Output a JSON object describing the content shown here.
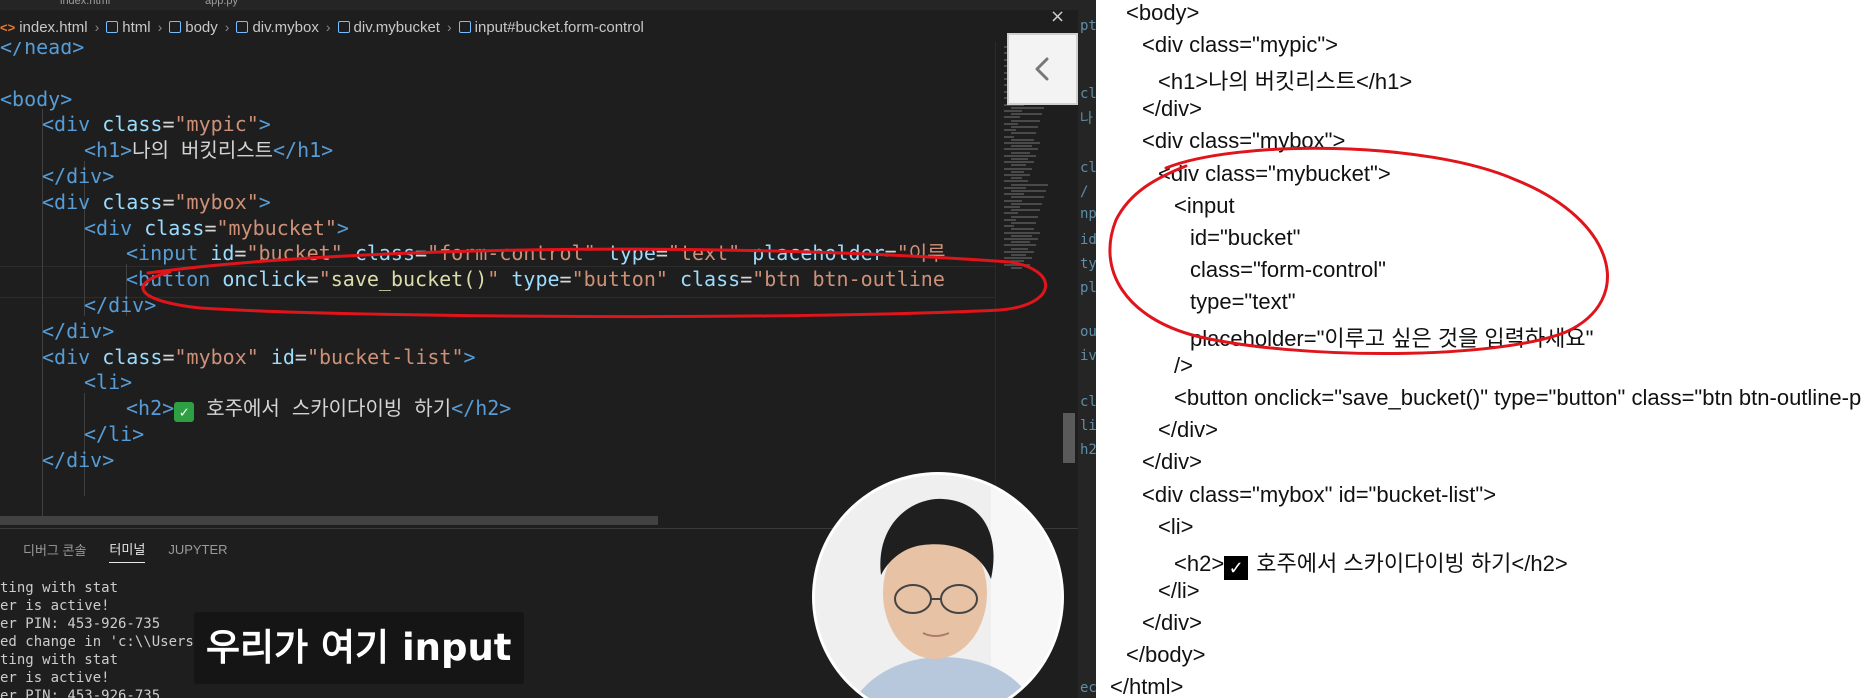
{
  "editor": {
    "tabs": [
      "index.html",
      "app.py"
    ],
    "breadcrumb": [
      "index.html",
      "html",
      "body",
      "div.mybox",
      "div.mybucket",
      "input#bucket.form-control"
    ],
    "code_lines": [
      {
        "indent": 0,
        "tokens": [
          {
            "t": "tag",
            "v": "</head>"
          }
        ]
      },
      {
        "indent": 0,
        "tokens": []
      },
      {
        "indent": 0,
        "tokens": [
          {
            "t": "tag",
            "v": "<body>"
          }
        ]
      },
      {
        "indent": 1,
        "tokens": [
          {
            "t": "tag",
            "v": "<div"
          },
          {
            "t": "txt",
            "v": " "
          },
          {
            "t": "attr",
            "v": "class"
          },
          {
            "t": "txt",
            "v": "="
          },
          {
            "t": "str",
            "v": "\"mypic\""
          },
          {
            "t": "tag",
            "v": ">"
          }
        ]
      },
      {
        "indent": 2,
        "tokens": [
          {
            "t": "tag",
            "v": "<h1>"
          },
          {
            "t": "txt",
            "v": "나의 버킷리스트"
          },
          {
            "t": "tag",
            "v": "</h1>"
          }
        ]
      },
      {
        "indent": 1,
        "tokens": [
          {
            "t": "tag",
            "v": "</div>"
          }
        ]
      },
      {
        "indent": 1,
        "tokens": [
          {
            "t": "tag",
            "v": "<div"
          },
          {
            "t": "txt",
            "v": " "
          },
          {
            "t": "attr",
            "v": "class"
          },
          {
            "t": "txt",
            "v": "="
          },
          {
            "t": "str",
            "v": "\"mybox\""
          },
          {
            "t": "tag",
            "v": ">"
          }
        ]
      },
      {
        "indent": 2,
        "tokens": [
          {
            "t": "tag",
            "v": "<div"
          },
          {
            "t": "txt",
            "v": " "
          },
          {
            "t": "attr",
            "v": "class"
          },
          {
            "t": "txt",
            "v": "="
          },
          {
            "t": "str",
            "v": "\"mybucket\""
          },
          {
            "t": "tag",
            "v": ">"
          }
        ]
      },
      {
        "indent": 3,
        "tokens": [
          {
            "t": "tag",
            "v": "<input"
          },
          {
            "t": "txt",
            "v": " "
          },
          {
            "t": "attr",
            "v": "id"
          },
          {
            "t": "txt",
            "v": "="
          },
          {
            "t": "str",
            "v": "\"bucket\""
          },
          {
            "t": "txt",
            "v": " "
          },
          {
            "t": "attr",
            "v": "class"
          },
          {
            "t": "txt",
            "v": "="
          },
          {
            "t": "str",
            "v": "\"form-control\""
          },
          {
            "t": "txt",
            "v": " "
          },
          {
            "t": "attr",
            "v": "type"
          },
          {
            "t": "txt",
            "v": "="
          },
          {
            "t": "str",
            "v": "\"text\""
          },
          {
            "t": "txt",
            "v": " "
          },
          {
            "t": "attr",
            "v": "placeholder"
          },
          {
            "t": "txt",
            "v": "="
          },
          {
            "t": "str",
            "v": "\"이루"
          }
        ]
      },
      {
        "indent": 3,
        "tokens": [
          {
            "t": "tag",
            "v": "<button"
          },
          {
            "t": "txt",
            "v": " "
          },
          {
            "t": "attr",
            "v": "onclick"
          },
          {
            "t": "txt",
            "v": "="
          },
          {
            "t": "str",
            "v": "\""
          },
          {
            "t": "fn",
            "v": "save_bucket"
          },
          {
            "t": "fn",
            "v": "()"
          },
          {
            "t": "str",
            "v": "\""
          },
          {
            "t": "txt",
            "v": " "
          },
          {
            "t": "attr",
            "v": "type"
          },
          {
            "t": "txt",
            "v": "="
          },
          {
            "t": "str",
            "v": "\"button\""
          },
          {
            "t": "txt",
            "v": " "
          },
          {
            "t": "attr",
            "v": "class"
          },
          {
            "t": "txt",
            "v": "="
          },
          {
            "t": "str",
            "v": "\"btn btn-outline"
          }
        ]
      },
      {
        "indent": 2,
        "tokens": [
          {
            "t": "tag",
            "v": "</div>"
          }
        ]
      },
      {
        "indent": 1,
        "tokens": [
          {
            "t": "tag",
            "v": "</div>"
          }
        ]
      },
      {
        "indent": 1,
        "tokens": [
          {
            "t": "tag",
            "v": "<div"
          },
          {
            "t": "txt",
            "v": " "
          },
          {
            "t": "attr",
            "v": "class"
          },
          {
            "t": "txt",
            "v": "="
          },
          {
            "t": "str",
            "v": "\"mybox\""
          },
          {
            "t": "txt",
            "v": " "
          },
          {
            "t": "attr",
            "v": "id"
          },
          {
            "t": "txt",
            "v": "="
          },
          {
            "t": "str",
            "v": "\"bucket-list\""
          },
          {
            "t": "tag",
            "v": ">"
          }
        ]
      },
      {
        "indent": 2,
        "tokens": [
          {
            "t": "tag",
            "v": "<li>"
          }
        ]
      },
      {
        "indent": 3,
        "tokens": [
          {
            "t": "tag",
            "v": "<h2>"
          },
          {
            "t": "check",
            "v": "✓"
          },
          {
            "t": "txt",
            "v": " 호주에서 스카이다이빙 하기"
          },
          {
            "t": "tag",
            "v": "</h2>"
          }
        ]
      },
      {
        "indent": 2,
        "tokens": [
          {
            "t": "tag",
            "v": "</li>"
          }
        ]
      },
      {
        "indent": 1,
        "tokens": [
          {
            "t": "tag",
            "v": "</div>"
          }
        ]
      }
    ]
  },
  "panel": {
    "tabs": [
      "디버그 콘솔",
      "터미널",
      "JUPYTER"
    ],
    "active_tab": "터미널",
    "close_label": "×",
    "terminal_lines": [
      "ting with stat",
      "er is active!",
      "er PIN: 453-926-735",
      "ed change in 'c:\\\\Users\\                                               bucket\\\\app.py', reloading",
      "ting with stat",
      "er is active!",
      "er PIN: 453-926-735"
    ]
  },
  "subtitle": "우리가 여기 input",
  "right_strip_fragments": [
    "pt",
    "cla",
    "나",
    "cla",
    "/ c",
    "np",
    "id",
    "ty",
    "pl",
    "out",
    "iv",
    "cla",
    "li",
    "h2",
    "ec"
  ],
  "slide": {
    "lines": [
      {
        "indent": 1,
        "text": "<body>"
      },
      {
        "indent": 2,
        "text": "<div class=\"mypic\">"
      },
      {
        "indent": 3,
        "text": "<h1>나의 버킷리스트</h1>"
      },
      {
        "indent": 2,
        "text": "</div>"
      },
      {
        "indent": 2,
        "text": "<div class=\"mybox\">"
      },
      {
        "indent": 3,
        "text": "<div class=\"mybucket\">"
      },
      {
        "indent": 4,
        "text": "<input"
      },
      {
        "indent": 5,
        "text": "id=\"bucket\""
      },
      {
        "indent": 5,
        "text": "class=\"form-control\""
      },
      {
        "indent": 5,
        "text": "type=\"text\""
      },
      {
        "indent": 5,
        "text": "placeholder=\"이루고 싶은 것을 입력하세요\""
      },
      {
        "indent": 4,
        "text": "/>"
      },
      {
        "indent": 4,
        "text": "<button onclick=\"save_bucket()\" type=\"button\" class=\"btn btn-outline-primary\">"
      },
      {
        "indent": 3,
        "text": "</div>"
      },
      {
        "indent": 2,
        "text": "</div>"
      },
      {
        "indent": 2,
        "text": "<div class=\"mybox\" id=\"bucket-list\">"
      },
      {
        "indent": 3,
        "text": "<li>"
      },
      {
        "indent": 4,
        "text": "<h2>",
        "check": "✓",
        "rest": " 호주에서 스카이다이빙 하기</h2>"
      },
      {
        "indent": 3,
        "text": "</li>"
      },
      {
        "indent": 2,
        "text": "</div>"
      },
      {
        "indent": 1,
        "text": "</body>"
      },
      {
        "indent": 0,
        "text": "</html>"
      }
    ]
  },
  "colors": {
    "tag": "#569cd6",
    "attribute": "#9cdcfe",
    "string": "#ce9178",
    "function": "#dcdcaa",
    "annotation": "#e0141b",
    "check_green": "#2ea043"
  },
  "icons": [
    "code-file-icon",
    "cube-icon",
    "chevron-left-icon",
    "close-icon",
    "checkbox-icon"
  ]
}
